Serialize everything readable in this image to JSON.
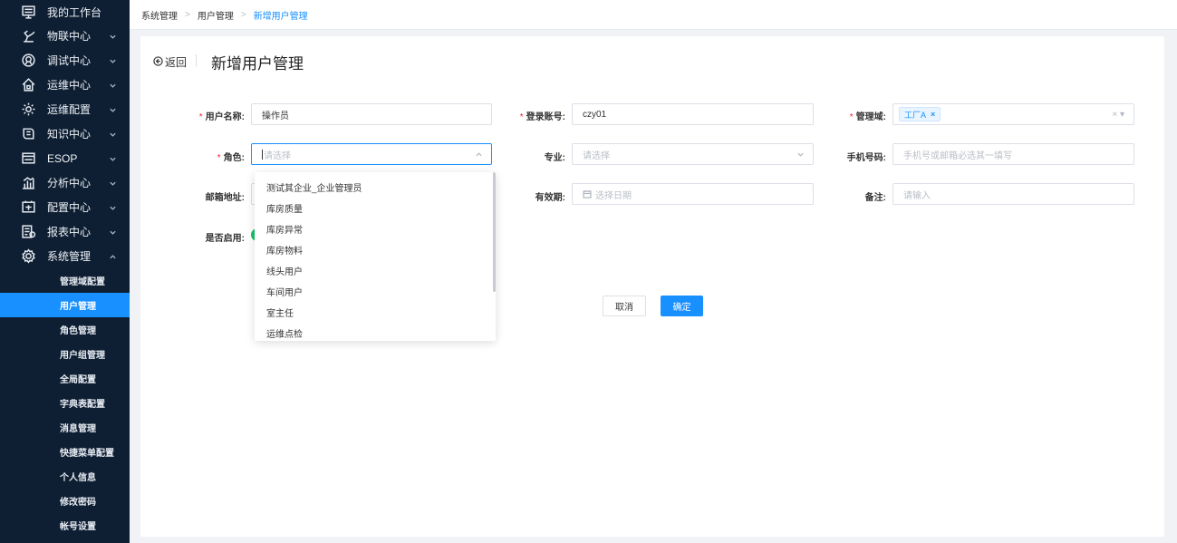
{
  "sidebar": {
    "items": [
      {
        "label": "我的工作台",
        "icon": "monitor-icon"
      },
      {
        "label": "物联中心",
        "icon": "robot-arm-icon"
      },
      {
        "label": "调试中心",
        "icon": "debug-icon"
      },
      {
        "label": "运维中心",
        "icon": "home-icon"
      },
      {
        "label": "运维配置",
        "icon": "gear-icon"
      },
      {
        "label": "知识中心",
        "icon": "book-icon"
      },
      {
        "label": "ESOP",
        "icon": "esop-icon"
      },
      {
        "label": "分析中心",
        "icon": "chart-icon"
      },
      {
        "label": "配置中心",
        "icon": "config-icon"
      },
      {
        "label": "报表中心",
        "icon": "report-icon"
      },
      {
        "label": "系统管理",
        "icon": "settings-icon"
      }
    ],
    "submenu": [
      {
        "label": "管理域配置"
      },
      {
        "label": "用户管理"
      },
      {
        "label": "角色管理"
      },
      {
        "label": "用户组管理"
      },
      {
        "label": "全局配置"
      },
      {
        "label": "字典表配置"
      },
      {
        "label": "消息管理"
      },
      {
        "label": "快捷菜单配置"
      },
      {
        "label": "个人信息"
      },
      {
        "label": "修改密码"
      },
      {
        "label": "帐号设置"
      }
    ]
  },
  "breadcrumb": {
    "items": [
      "系统管理",
      "用户管理",
      "新增用户管理"
    ]
  },
  "header": {
    "back_label": "返回",
    "title": "新增用户管理"
  },
  "form": {
    "username": {
      "label": "用户名称:",
      "value": "操作员"
    },
    "account": {
      "label": "登录账号:",
      "value": "czy01"
    },
    "domain": {
      "label": "管理域:",
      "tag": "工厂A",
      "tag_close": "×",
      "clear": "× ▾"
    },
    "role": {
      "label": "角色:",
      "placeholder": "请选择"
    },
    "major": {
      "label": "专业:",
      "placeholder": "请选择"
    },
    "phone": {
      "label": "手机号码:",
      "placeholder": "手机号或邮箱必选其一填写"
    },
    "email": {
      "label": "邮箱地址:"
    },
    "validity": {
      "label": "有效期:",
      "placeholder": "选择日期"
    },
    "remark": {
      "label": "备注:",
      "placeholder": "请输入"
    },
    "enabled": {
      "label": "是否启用:"
    }
  },
  "buttons": {
    "cancel": "取消",
    "ok": "确定"
  },
  "role_dropdown": {
    "options": [
      "测试其企业_企业管理员",
      "库房质量",
      "库房异常",
      "库房物料",
      "线头用户",
      "车间用户",
      "室主任",
      "运维点检"
    ]
  },
  "colors": {
    "sidebar_bg": "#0f1f33",
    "accent": "#1890ff",
    "required": "#f5222d",
    "switch_on": "#13c26b"
  }
}
